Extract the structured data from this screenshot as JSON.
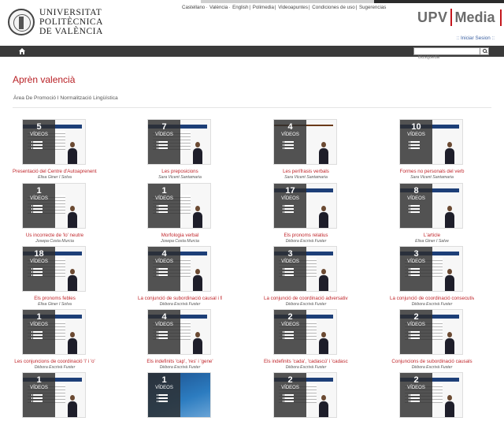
{
  "header": {
    "university_name_lines": [
      "UNIVERSITAT",
      "POLITÈCNICA",
      "DE VALÈNCIA"
    ],
    "top_links": [
      "Castellano",
      "València",
      "English",
      "Polimedia",
      "Videoapuntes",
      "Condiciones de uso",
      "Sugerencias"
    ],
    "brand_upv": "UPV",
    "brand_media": "Media",
    "login_label": ":: Iniciar Sesion ::"
  },
  "navbar": {
    "search_placeholder": "Búsqueda"
  },
  "page": {
    "title": "Aprèn valencià",
    "subtitle": "Àrea De Promoció I Normalització Lingüística"
  },
  "videos_label": "VÍDEOS",
  "cards": [
    {
      "count": "5",
      "title": "Presentació del Centre d'Autoaprenentatge d...",
      "author": "Elisa Giner I Solva"
    },
    {
      "count": "7",
      "title": "Les preposicions",
      "author": "Sara Vicent Santamaria"
    },
    {
      "count": "4",
      "title": "Les perífrasis verbals",
      "author": "Sara Vicent Santamaria"
    },
    {
      "count": "10",
      "title": "Formes no personals del verb",
      "author": "Sara Vicent Santamaria"
    },
    {
      "count": "1",
      "title": "Us incorrecte de 'lo' neutre",
      "author": "Josepa Costa Murcia"
    },
    {
      "count": "1",
      "title": "Morfologia verbal",
      "author": "Josepa Costa Murcia"
    },
    {
      "count": "17",
      "title": "Els pronoms relatius",
      "author": "Dèbora Escrivà Fuster"
    },
    {
      "count": "8",
      "title": "L'article",
      "author": "Elisa Giner I Salve"
    },
    {
      "count": "18",
      "title": "Els pronoms febles",
      "author": "Elisa Giner I Solva"
    },
    {
      "count": "4",
      "title": "La conjunció de subordinació causal i final 'pe...",
      "author": "Dèbora Escrivà Fuster"
    },
    {
      "count": "3",
      "title": "La conjunció de coordinació adversativa 'sinó'",
      "author": "Dèbora Escrivà Fuster"
    },
    {
      "count": "3",
      "title": "La conjunció de coordinació consecutiva i con...",
      "author": "Dèbora Escrivà Fuster"
    },
    {
      "count": "1",
      "title": "Les conjuncions de coordinació 'i' i 'o'",
      "author": "Dèbora Escrivà Fuster"
    },
    {
      "count": "4",
      "title": "Els indefinits 'cap', 'res' i 'gene'",
      "author": "Dèbora Escrivà Fuster"
    },
    {
      "count": "2",
      "title": "Els indefinits 'cada', 'cadascú' i 'cadascun'",
      "author": "Dèbora Escrivà Fuster"
    },
    {
      "count": "2",
      "title": "Conjuncions de subordinació causals",
      "author": "Dèbora Escrivà Fuster"
    },
    {
      "count": "1",
      "title": "",
      "author": ""
    },
    {
      "count": "1",
      "title": "",
      "author": ""
    },
    {
      "count": "2",
      "title": "",
      "author": ""
    },
    {
      "count": "2",
      "title": "",
      "author": ""
    }
  ]
}
